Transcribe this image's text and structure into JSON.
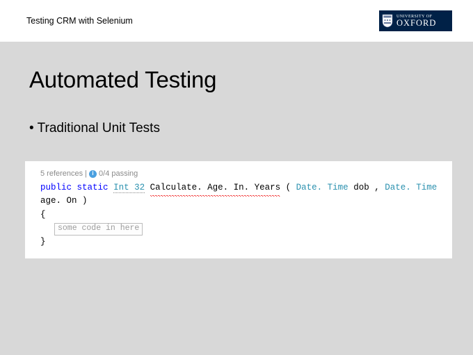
{
  "header": {
    "title": "Testing CRM with Selenium",
    "badge": {
      "top": "UNIVERSITY OF",
      "bottom": "OXFORD"
    }
  },
  "slide": {
    "title": "Automated Testing",
    "bullet": "• Traditional Unit Tests"
  },
  "code": {
    "codelens_refs": "5 references",
    "codelens_sep": " | ",
    "codelens_pass": "0/4 passing",
    "kw_public": "public",
    "kw_static": "static",
    "type_int32": "Int 32",
    "method_name": "Calculate. Age. In. Years",
    "paren_open": "(",
    "type_datetime1": "Date. Time",
    "param1": "dob",
    "comma": ", ",
    "type_datetime2": "Date. Time",
    "param2": "age. On",
    "paren_close": ")",
    "brace_open": "{",
    "placeholder": "some code in here",
    "brace_close": "}"
  }
}
